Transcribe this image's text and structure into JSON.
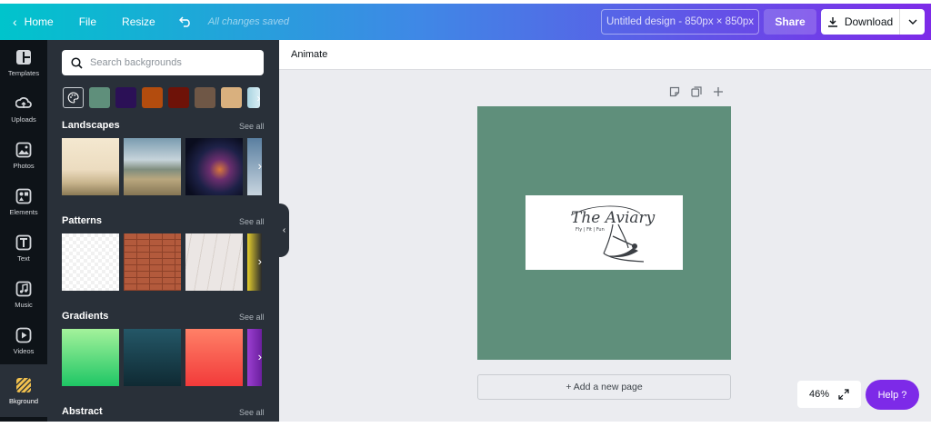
{
  "topbar": {
    "home_label": "Home",
    "file_label": "File",
    "resize_label": "Resize",
    "saved_status": "All changes saved",
    "doc_title": "Untitled design - 850px × 850px",
    "share_label": "Share",
    "download_label": "Download"
  },
  "rail": {
    "items": [
      {
        "label": "Templates"
      },
      {
        "label": "Uploads"
      },
      {
        "label": "Photos"
      },
      {
        "label": "Elements"
      },
      {
        "label": "Text"
      },
      {
        "label": "Music"
      },
      {
        "label": "Videos"
      },
      {
        "label": "Bkground"
      }
    ]
  },
  "panel": {
    "search_placeholder": "Search backgrounds",
    "swatches": [
      "#5f8f7b",
      "#2b1056",
      "#b34c0e",
      "#6e1208",
      "#6f5746",
      "#d9b07e"
    ],
    "sections": [
      {
        "title": "Landscapes",
        "see_all": "See all"
      },
      {
        "title": "Patterns",
        "see_all": "See all"
      },
      {
        "title": "Gradients",
        "see_all": "See all"
      },
      {
        "title": "Abstract",
        "see_all": "See all"
      }
    ]
  },
  "editor": {
    "animate_label": "Animate",
    "page_color": "#5f8f7b",
    "logo": {
      "name": "The Aviary",
      "tagline": "Fly | Fit | Fun"
    },
    "add_page_label": "+ Add a new page",
    "zoom_label": "46%",
    "help_label": "Help ?"
  }
}
